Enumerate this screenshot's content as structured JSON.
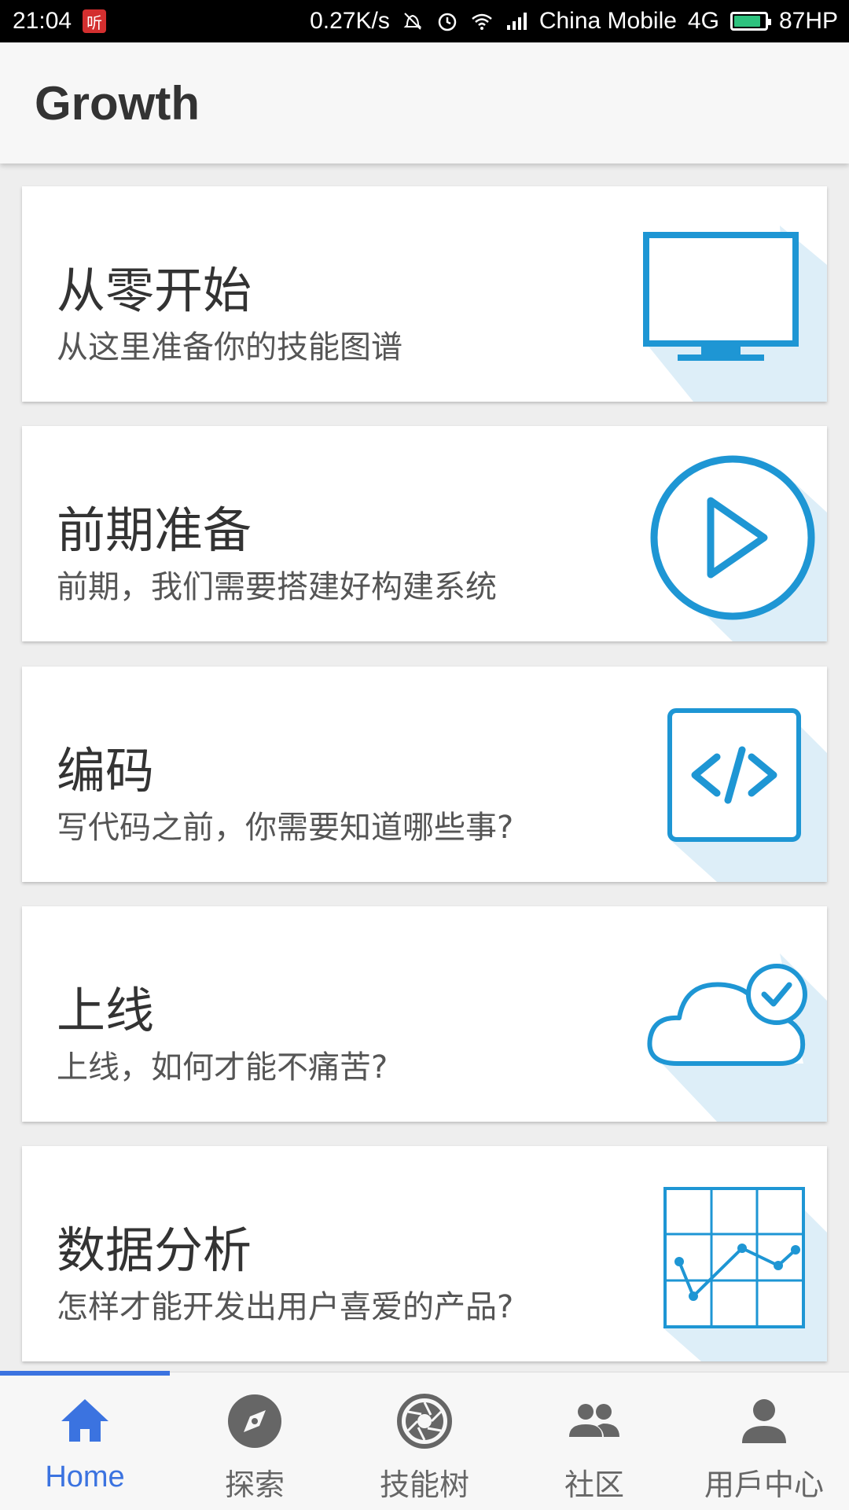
{
  "status_bar": {
    "time": "21:04",
    "app_badge": "听",
    "net_speed": "0.27K/s",
    "carrier": "China Mobile",
    "network": "4G",
    "battery": "87HP",
    "battery_level": 0.87
  },
  "appbar": {
    "title": "Growth"
  },
  "colors": {
    "accent": "#3b73e0",
    "icon_blue": "#1e96d4",
    "icon_shadow": "#ddeef8"
  },
  "cards": [
    {
      "title": "从零开始",
      "subtitle": "从这里准备你的技能图谱",
      "icon": "monitor-icon"
    },
    {
      "title": "前期准备",
      "subtitle": "前期，我们需要搭建好构建系统",
      "icon": "play-circle-icon"
    },
    {
      "title": "编码",
      "subtitle": "写代码之前，你需要知道哪些事?",
      "icon": "code-icon"
    },
    {
      "title": "上线",
      "subtitle": "上线，如何才能不痛苦?",
      "icon": "cloud-check-icon"
    },
    {
      "title": "数据分析",
      "subtitle": "怎样才能开发出用户喜爱的产品?",
      "icon": "chart-grid-icon"
    }
  ],
  "bottom_nav": {
    "items": [
      {
        "label": "Home",
        "icon": "home-icon",
        "active": true
      },
      {
        "label": "探索",
        "icon": "compass-icon",
        "active": false
      },
      {
        "label": "技能树",
        "icon": "aperture-icon",
        "active": false
      },
      {
        "label": "社区",
        "icon": "group-icon",
        "active": false
      },
      {
        "label": "用戶中心",
        "icon": "person-icon",
        "active": false
      }
    ]
  }
}
